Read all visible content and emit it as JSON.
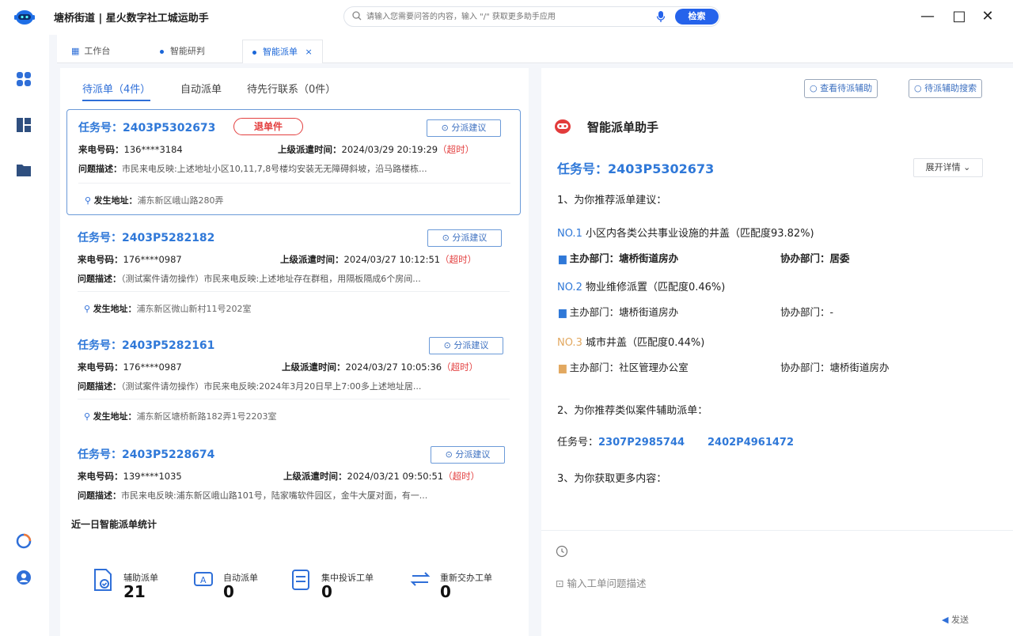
{
  "app": {
    "title": "塘桥街道 | 星火数字社工城运助手",
    "search_placeholder": "请输入您需要问答的内容，输入 \"/\" 获取更多助手应用",
    "search_button": "检索",
    "accent": "#2f6fd8"
  },
  "tabs": [
    {
      "label": "工作台"
    },
    {
      "label": "智能研判"
    },
    {
      "label": "智能派单",
      "close": "×"
    }
  ],
  "subtabs": [
    {
      "label": "待派单（4件）"
    },
    {
      "label": "自动派单"
    },
    {
      "label": "待先行联系（0件）"
    }
  ],
  "labels": {
    "task_prefix": "任务号：",
    "phone": "来电号码：",
    "dispatch_time": "上级派遣时间：",
    "desc": "问题描述：",
    "addr": "发生地址：",
    "assign": "分派建议",
    "overtime": "（超时）"
  },
  "tickets": [
    {
      "task": "2403P5302673",
      "badge": "退单件",
      "phone": "136****3184",
      "time": "2024/03/29 20:19:29",
      "desc": "市民来电反映:上述地址小区10,11,7,8号楼均安装无无障碍斜坡，沿马路楼栋...",
      "addr": "浦东新区峨山路280弄"
    },
    {
      "task": "2403P5282182",
      "phone": "176****0987",
      "time": "2024/03/27 10:12:51",
      "desc": "（测试案件请勿操作）市民来电反映:上述地址存在群租，用隔板隔成6个房间...",
      "addr": "浦东新区微山新村11号202室"
    },
    {
      "task": "2403P5282161",
      "phone": "176****0987",
      "time": "2024/03/27 10:05:36",
      "desc": "（测试案件请勿操作）市民来电反映:2024年3月20日早上7:00多上述地址居...",
      "addr": "浦东新区塘桥新路182弄1号2203室"
    },
    {
      "task": "2403P5228674",
      "phone": "139****1035",
      "time": "2024/03/21 09:50:51",
      "desc": "市民来电反映:浦东新区峨山路101号，陆家嘴软件园区，金牛大厦对面，有一..."
    }
  ],
  "stats": {
    "title": "近一日智能派单统计",
    "items": [
      {
        "label": "辅助派单",
        "value": "21"
      },
      {
        "label": "自动派单",
        "value": "0"
      },
      {
        "label": "集中投诉工单",
        "value": "0"
      },
      {
        "label": "重新交办工单",
        "value": "0"
      }
    ]
  },
  "assistant": {
    "view_btn": "查看待派辅助",
    "search_btn": "待派辅助搜索",
    "title": "智能派单助手",
    "task_label": "任务号：",
    "task": "2403P5302673",
    "expand": "展开详情",
    "sec1": "1、为你推荐派单建议：",
    "recs": [
      {
        "no": "NO.1",
        "text": "小区内各类公共事业设施的井盖（匹配度93.82%)",
        "main": "塘桥街道房办",
        "co": "居委"
      },
      {
        "no": "NO.2",
        "text": "物业维修派置（匹配度0.46%)",
        "main": "塘桥街道房办",
        "co": "-"
      },
      {
        "no": "NO.3",
        "text": "城市井盖（匹配度0.44%)",
        "main": "社区管理办公室",
        "co": "塘桥街道房办"
      }
    ],
    "main_label": "主办部门：",
    "co_label": "协办部门：",
    "sec2": "2、为你推荐类似案件辅助派单：",
    "similar_label": "任务号：",
    "similar": [
      "2307P2985744",
      "2402P4961472"
    ],
    "sec3": "3、为你获取更多内容：",
    "input_placeholder": "输入工单问题描述",
    "send": "发送"
  }
}
